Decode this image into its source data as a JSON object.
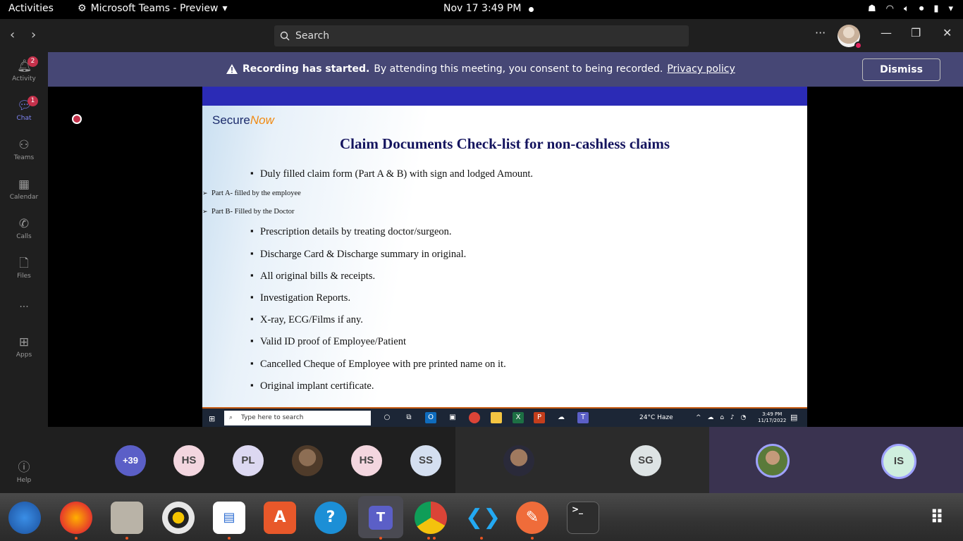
{
  "topbar": {
    "activities": "Activities",
    "app_name": "Microsoft Teams - Preview",
    "clock": "Nov 17  3:49 PM"
  },
  "titlebar": {
    "search_placeholder": "Search",
    "more": "···"
  },
  "rail": {
    "items": [
      {
        "label": "Activity",
        "icon": "bell-icon",
        "badge": "2"
      },
      {
        "label": "Chat",
        "icon": "chat-icon",
        "badge": "1"
      },
      {
        "label": "Teams",
        "icon": "teams-icon"
      },
      {
        "label": "Calendar",
        "icon": "calendar-icon"
      },
      {
        "label": "Calls",
        "icon": "phone-icon"
      },
      {
        "label": "Files",
        "icon": "file-icon"
      },
      {
        "label": "Apps",
        "icon": "apps-icon"
      },
      {
        "label": "Help",
        "icon": "help-icon"
      }
    ],
    "more": "···"
  },
  "banner": {
    "bold": "Recording has started.",
    "text": "By attending this meeting, you consent to being recorded.",
    "link": "Privacy policy",
    "dismiss": "Dismiss"
  },
  "slide": {
    "logo_main": "Secure",
    "logo_accent": "Now",
    "title": "Claim Documents Check-list for non-cashless claims",
    "items": [
      {
        "kind": "main",
        "text": "Duly filled claim form (Part A & B) with sign and lodged Amount."
      },
      {
        "kind": "sub",
        "text": "Part A- filled by the employee"
      },
      {
        "kind": "sub",
        "text": "Part B- Filled by the Doctor"
      },
      {
        "kind": "main",
        "text": "Prescription details by treating doctor/surgeon."
      },
      {
        "kind": "main",
        "text": "Discharge Card & Discharge summary in original."
      },
      {
        "kind": "main",
        "text": "All original bills & receipts."
      },
      {
        "kind": "main",
        "text": "Investigation Reports."
      },
      {
        "kind": "main",
        "text": "X-ray, ECG/Films if any."
      },
      {
        "kind": "main",
        "text": "Valid ID proof of Employee/Patient"
      },
      {
        "kind": "main",
        "text": "Cancelled Cheque of Employee with pre printed name on it."
      },
      {
        "kind": "main",
        "text": "Original implant certificate."
      }
    ]
  },
  "win_taskbar": {
    "search_placeholder": "Type here to search",
    "weather": "24°C  Haze",
    "time": "3:49 PM",
    "date": "11/17/2022"
  },
  "participants": [
    {
      "initials": "+39",
      "bg": "#5b5fc7",
      "fg": "#ffffff"
    },
    {
      "initials": "HS",
      "bg": "#f3d6df",
      "fg": "#444444"
    },
    {
      "initials": "PL",
      "bg": "#dcd8f1",
      "fg": "#444444"
    },
    {
      "initials": "",
      "bg": "#6b5a3e",
      "fg": "#ffffff",
      "photo": true
    },
    {
      "initials": "HS",
      "bg": "#f3d6df",
      "fg": "#444444"
    },
    {
      "initials": "SS",
      "bg": "#d4dff0",
      "fg": "#444444"
    }
  ],
  "tiles": [
    {
      "initials": "",
      "photo": true
    },
    {
      "initials": "SG"
    },
    {
      "initials": "",
      "photo": true
    },
    {
      "initials": "IS"
    }
  ],
  "colors": {
    "banner": "#464775",
    "rail": "#1f1f1f",
    "accent": "#7f85f5",
    "slide_bar": "#2b2bb6"
  }
}
